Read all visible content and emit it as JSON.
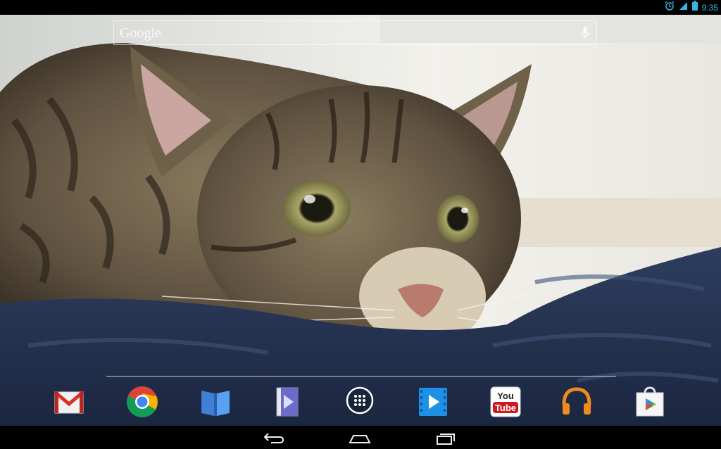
{
  "status_bar": {
    "time": "9:35",
    "icons": [
      "alarm-icon",
      "signal-icon",
      "battery-icon"
    ],
    "accent_color": "#33b5e5"
  },
  "search": {
    "logo_text": "Google",
    "icon": "mic-icon"
  },
  "wallpaper": {
    "description_icon": "cat-wallpaper"
  },
  "dock": {
    "apps": [
      {
        "id": "gmail",
        "icon": "gmail-icon"
      },
      {
        "id": "chrome",
        "icon": "chrome-icon"
      },
      {
        "id": "play-books",
        "icon": "play-books-icon"
      },
      {
        "id": "play-magazines",
        "icon": "play-magazines-icon"
      },
      {
        "id": "all-apps",
        "icon": "all-apps-icon"
      },
      {
        "id": "play-movies",
        "icon": "play-movies-icon"
      },
      {
        "id": "youtube",
        "icon": "youtube-icon",
        "label_top": "You",
        "label_bottom": "Tube"
      },
      {
        "id": "play-music",
        "icon": "headphones-icon"
      },
      {
        "id": "play-store",
        "icon": "play-store-icon"
      }
    ]
  },
  "nav_bar": {
    "buttons": [
      "back-icon",
      "home-icon",
      "recents-icon"
    ]
  }
}
